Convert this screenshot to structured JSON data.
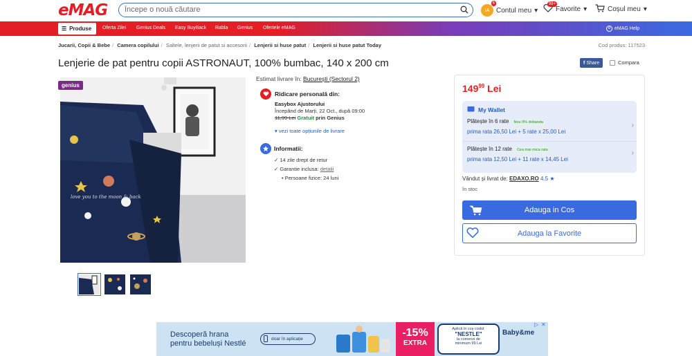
{
  "header": {
    "logo": "eMAG",
    "search_placeholder": "Începe o nouă căutare",
    "avatar_initials": "IA",
    "avatar_badge": "6",
    "account_label": "Contul meu",
    "favorites_badge": "99+",
    "favorites_label": "Favorite",
    "cart_label": "Coșul meu"
  },
  "nav": {
    "products_label": "Produse",
    "links": [
      "Oferta Zilei",
      "Genius Deals",
      "Easy BuyBack",
      "Rabla",
      "Genius",
      "Ofertele eMAG"
    ],
    "help_label": "eMAG Help"
  },
  "breadcrumb": [
    "Jucarii, Copii & Bebe",
    "Camera copilului",
    "Saltele, lenjerii de patut si accesorii",
    "Lenjerii si huse patut",
    "Lenjerii si huse patut Today"
  ],
  "product": {
    "code": "Cod produs: 117523",
    "title": "Lenjerie de pat pentru copii ASTRONAUT, 100% bumbac, 140 x 200 cm",
    "share_label": "Share",
    "compare_label": "Compara",
    "genius_badge": "genius",
    "image_text": "love you to the moon & back"
  },
  "delivery": {
    "estimate_label": "Estimat livrare în:",
    "estimate_location": "București (Sectorul 2)",
    "pickup_title": "Ridicare personală din:",
    "pickup_place": "Easybox Ajustorului",
    "pickup_date": "Începând de Marți, 22 Oct., după 09:00",
    "old_price": "11,99 Lei",
    "free_label": "Gratuit",
    "genius_label": "prin Genius",
    "more_options": "vezi toate opțiunile de livrare",
    "info_title": "Informatii:",
    "info_items": [
      "14 zile drept de retur",
      "Garantie inclusa:",
      "Persoane fizice: 24 luni"
    ],
    "details_link": "detalii"
  },
  "buy": {
    "price_int": "149",
    "price_dec": "99",
    "currency": "Lei",
    "wallet_label": "My Wallet",
    "rate6_title": "Plătește în 6 rate",
    "rate6_badge": "Nou 0% dobanda",
    "rate6_detail": "prima rata 26,50 Lei + 5 rate x 25,00 Lei",
    "rate12_title": "Plătește în 12 rate",
    "rate12_badge": "Cea mai mica rata",
    "rate12_detail": "prima rata 12,50 Lei + 11 rate x 14,45 Lei",
    "seller_label": "Vândut și livrat de:",
    "seller_name": "EDAXO.RO",
    "seller_rating": "4.5",
    "stock": "în stoc",
    "add_cart": "Adauga in Cos",
    "add_fav": "Adauga la Favorite"
  },
  "ad": {
    "headline_1": "Descoperă hrana",
    "headline_2": "pentru bebeluși Nestlé",
    "app_label": "doar în aplicație",
    "percent": "-15%",
    "extra": "EXTRA",
    "code_line1": "Aplică în coș codul:",
    "code": "\"NESTLE\"",
    "code_line2": "la comenzi de",
    "code_line3": "minimum 99 Lei",
    "brand": "Baby&me"
  }
}
